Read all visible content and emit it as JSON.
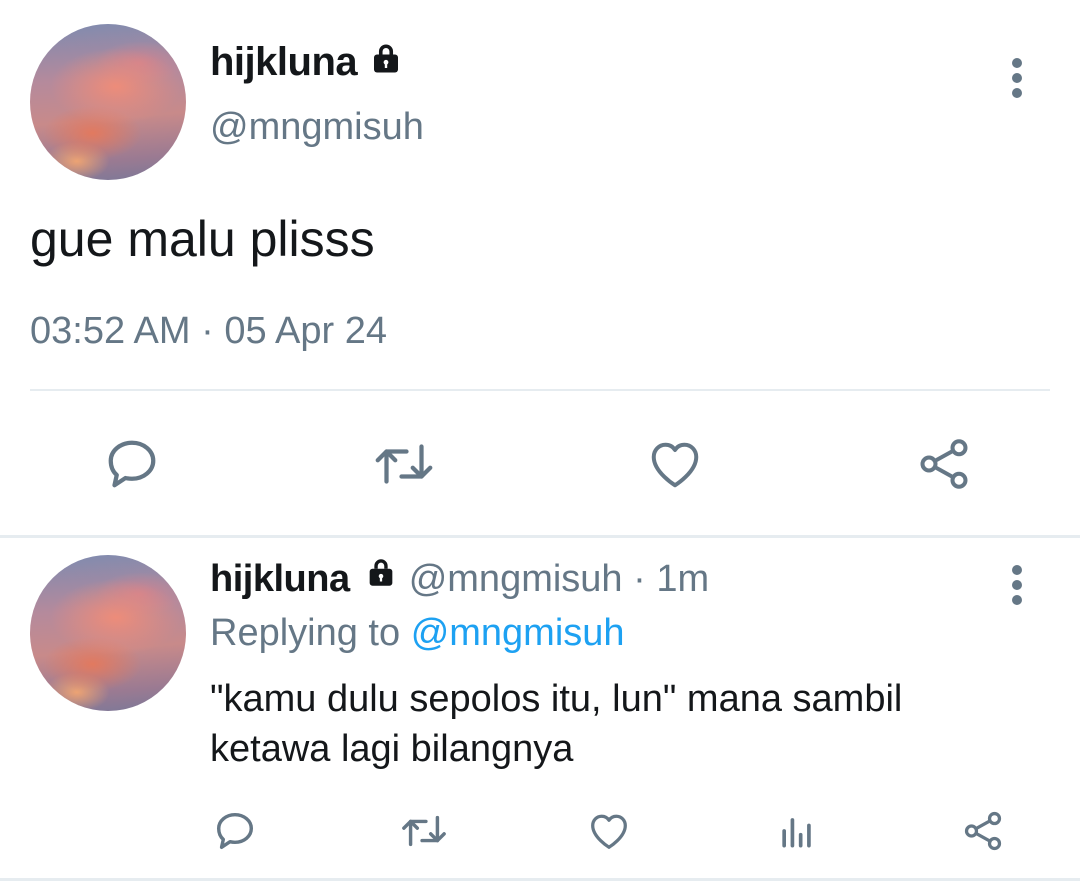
{
  "main_tweet": {
    "display_name": "hijkluna",
    "handle": "@mngmisuh",
    "text": "gue malu plisss",
    "timestamp": "03:52 AM · 05 Apr 24",
    "locked_icon": "lock-icon",
    "actions": [
      "reply-icon",
      "retweet-icon",
      "like-icon",
      "share-icon"
    ]
  },
  "reply_tweet": {
    "display_name": "hijkluna",
    "handle": "@mngmisuh",
    "separator": "·",
    "time_ago": "1m",
    "replying_prefix": "Replying to",
    "replying_to": "@mngmisuh",
    "text": "\"kamu dulu sepolos itu, lun\" mana sambil ketawa lagi bilangnya",
    "locked_icon": "lock-icon",
    "actions": [
      "reply-icon",
      "retweet-icon",
      "like-icon",
      "analytics-icon",
      "share-icon"
    ]
  },
  "colors": {
    "text_primary": "#14171a",
    "text_secondary": "#657786",
    "link": "#1da1f2",
    "divider": "#e6ecf0"
  }
}
